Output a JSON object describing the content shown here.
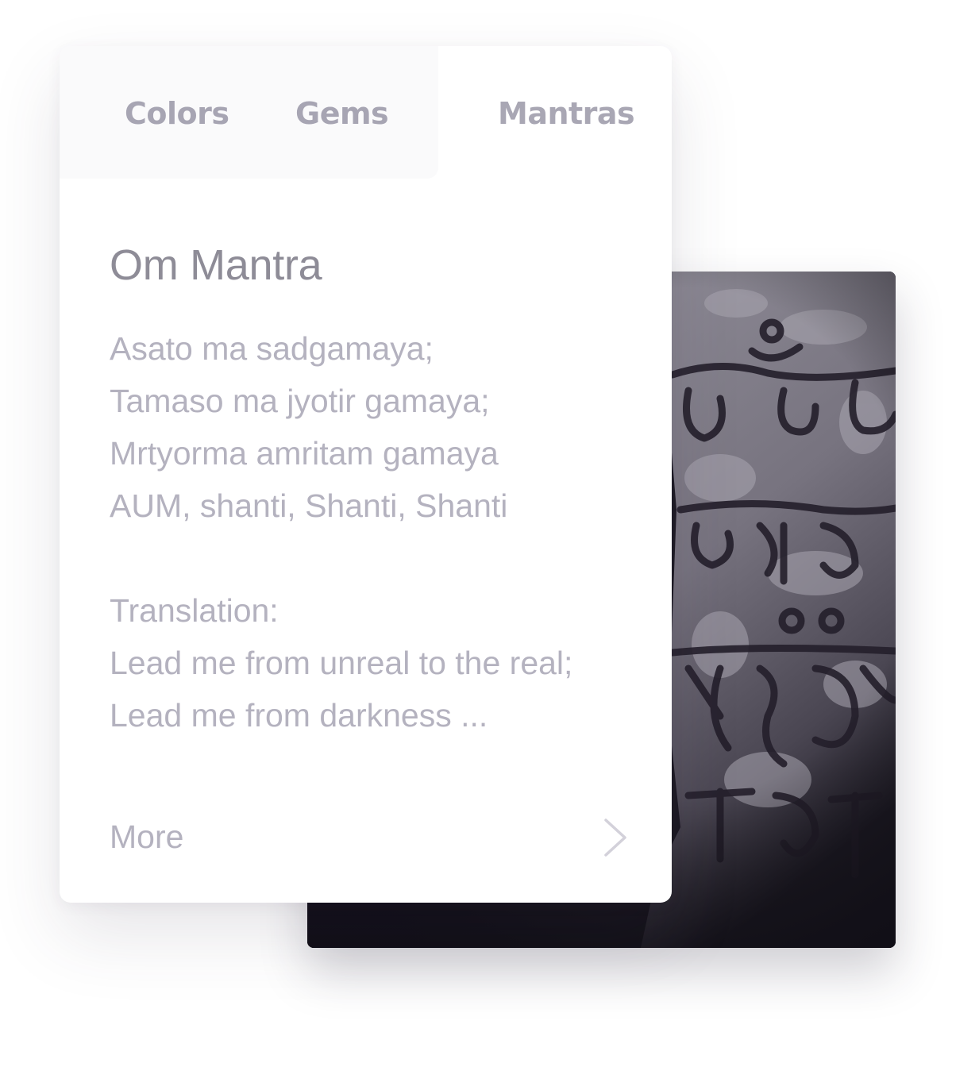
{
  "tabs": {
    "colors": "Colors",
    "gems": "Gems",
    "mantras": "Mantras",
    "active": "Mantras"
  },
  "content": {
    "title": "Om Mantra",
    "lines": [
      "Asato ma sadgamaya;",
      "Tamaso ma jyotir gamaya;",
      "Mrtyorma amritam gamaya",
      "AUM, shanti, Shanti, Shanti",
      "",
      "Translation:",
      "Lead me from unreal to the real;",
      "Lead me from darkness ..."
    ],
    "more_label": "More"
  },
  "icons": {
    "more": "chevron-right-icon"
  },
  "colors": {
    "text": "#b4b2bf",
    "title": "#8e8c97",
    "tab": "#a7a5b3",
    "tab_inactive_bg": "#fafafb",
    "photo_bg": "#1d1a24"
  }
}
